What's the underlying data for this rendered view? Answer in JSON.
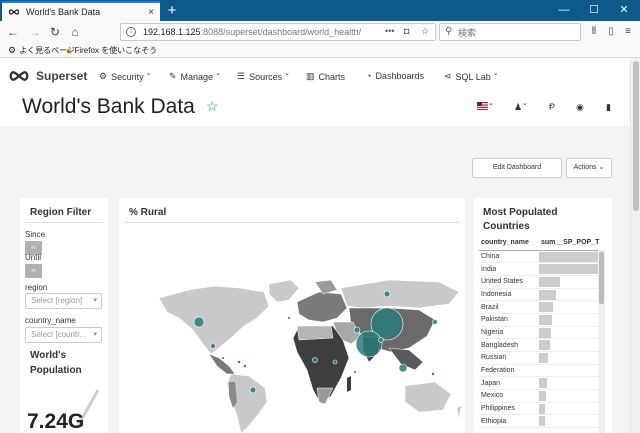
{
  "browser": {
    "tab_title": "World's Bank Data",
    "tab_close": "×",
    "new_tab": "+",
    "url_host": "192.168.1.125",
    "url_rest": ":8088/superset/dashboard/world_health/",
    "search_placeholder": "検索",
    "bookmarks": [
      {
        "icon": "gear-icon",
        "label": "よく見るページ"
      },
      {
        "icon": "firefox-icon",
        "label": "Firefox を使いこなそう"
      }
    ]
  },
  "app": {
    "brand": "Superset",
    "menu": [
      {
        "icon": "gears-icon",
        "label": "Security",
        "dropdown": true
      },
      {
        "icon": "wrench-icon",
        "label": "Manage",
        "dropdown": true
      },
      {
        "icon": "database-icon",
        "label": "Sources",
        "dropdown": true
      },
      {
        "icon": "bar-chart-icon",
        "label": "Charts",
        "dropdown": false
      },
      {
        "icon": "dashboard-icon",
        "label": "Dashboards",
        "dropdown": false
      },
      {
        "icon": "share-icon",
        "label": "SQL Lab",
        "dropdown": true
      }
    ],
    "right_nav": {
      "lang_flag": "us-flag-icon",
      "user": "user-icon",
      "version": "version-icon",
      "github": "github-icon",
      "docs": "book-icon"
    }
  },
  "dashboard": {
    "title": "World's Bank Data",
    "edit_button": "Edit Dashboard",
    "actions_button": "Actions"
  },
  "region_filter": {
    "title": "Region Filter",
    "since_label": "Since",
    "until_label": "Until",
    "region_label": "region",
    "region_placeholder": "Select [region]",
    "country_label": "country_name",
    "country_placeholder": "Select [countr..."
  },
  "population": {
    "title_line1": "World's",
    "title_line2": "Population",
    "value": "7.24G"
  },
  "rural_map": {
    "title": "% Rural",
    "colors": {
      "land": "#c9c9c9",
      "dark": "#3e3e3e",
      "mid": "#7a7a7a",
      "bubble": "#2a7a7a"
    }
  },
  "most_populated": {
    "title_line1": "Most Populated",
    "title_line2": "Countries",
    "columns": [
      "country_name",
      "sum__SP_POP_T"
    ],
    "rows": [
      {
        "country": "China",
        "bar": 1.0
      },
      {
        "country": "India",
        "bar": 0.98
      },
      {
        "country": "United States",
        "bar": 0.34
      },
      {
        "country": "Indonesia",
        "bar": 0.28
      },
      {
        "country": "Brazil",
        "bar": 0.22
      },
      {
        "country": "Pakistan",
        "bar": 0.21
      },
      {
        "country": "Nigeria",
        "bar": 0.19
      },
      {
        "country": "Bangladesh",
        "bar": 0.17
      },
      {
        "country": "Russian",
        "bar": 0.15
      },
      {
        "country": "Federation",
        "bar": 0.0
      },
      {
        "country": "Japan",
        "bar": 0.13
      },
      {
        "country": "Mexico",
        "bar": 0.12
      },
      {
        "country": "Philippines",
        "bar": 0.1
      },
      {
        "country": "Ethiopia",
        "bar": 0.09
      }
    ]
  }
}
